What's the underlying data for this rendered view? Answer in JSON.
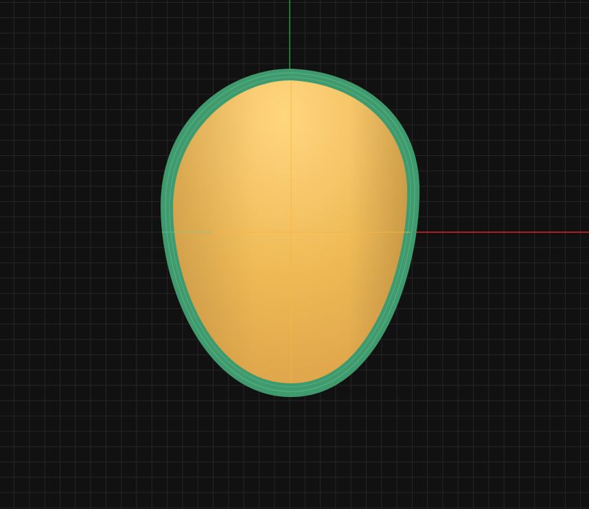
{
  "viewport": {
    "background": "#111111",
    "grid_minor_color": "#262626",
    "grid_major_color": "#2e2e2e"
  },
  "axes": {
    "x_axis_color": "#e0242d",
    "y_axis_color": "#2fbf3f"
  },
  "model": {
    "shape": "egg-outline",
    "rim_color": "#3f9a6e",
    "rim_highlight_color": "#6cc79a",
    "fill_top_color": "#ffd67e",
    "fill_mid_color": "#efb956",
    "fill_bottom_color": "#dca349",
    "guide_line_color": "#f3b64a"
  }
}
